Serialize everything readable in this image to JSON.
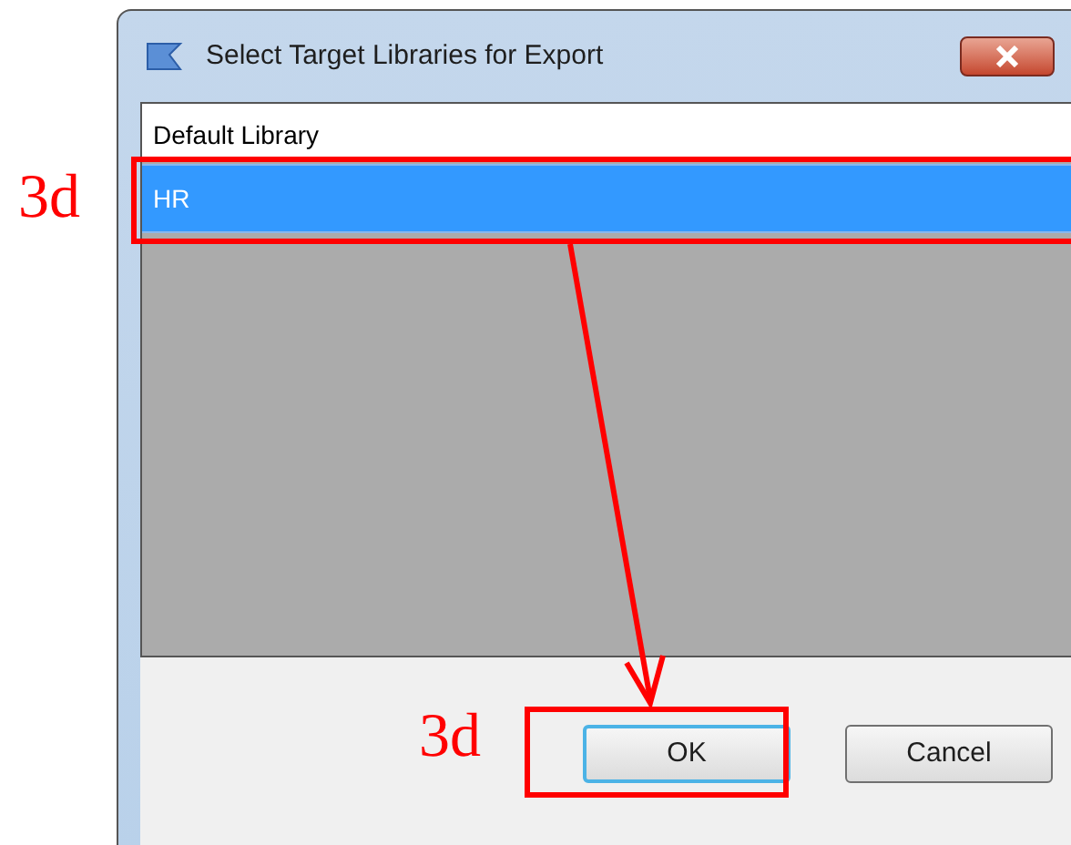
{
  "window": {
    "title": "Select Target Libraries for Export"
  },
  "list": {
    "items": [
      {
        "label": "Default Library",
        "selected": false
      },
      {
        "label": "HR",
        "selected": true
      }
    ]
  },
  "buttons": [
    {
      "label": "OK",
      "focused": true
    },
    {
      "label": "Cancel",
      "focused": false
    }
  ],
  "annotations": [
    {
      "label": "3d"
    },
    {
      "label": "3d"
    }
  ]
}
